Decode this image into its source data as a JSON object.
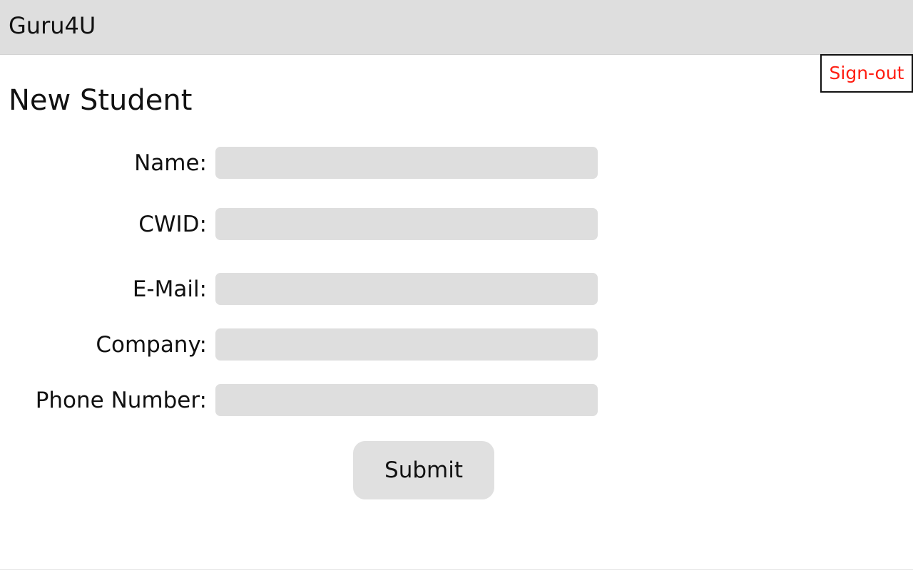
{
  "app": {
    "title": "Guru4U",
    "signout_label": "Sign-out"
  },
  "page": {
    "title": "New Student"
  },
  "form": {
    "fields": [
      {
        "label": "Name:",
        "value": "",
        "placeholder": ""
      },
      {
        "label": "CWID:",
        "value": "",
        "placeholder": ""
      },
      {
        "label": "E-Mail:",
        "value": "",
        "placeholder": ""
      },
      {
        "label": "Company:",
        "value": "",
        "placeholder": ""
      },
      {
        "label": "Phone Number:",
        "value": "",
        "placeholder": ""
      }
    ],
    "submit_label": "Submit"
  },
  "colors": {
    "header_background": "#dedede",
    "signout_text": "#ff1e12",
    "input_background": "#dedede",
    "button_background": "#e0e0e0"
  }
}
